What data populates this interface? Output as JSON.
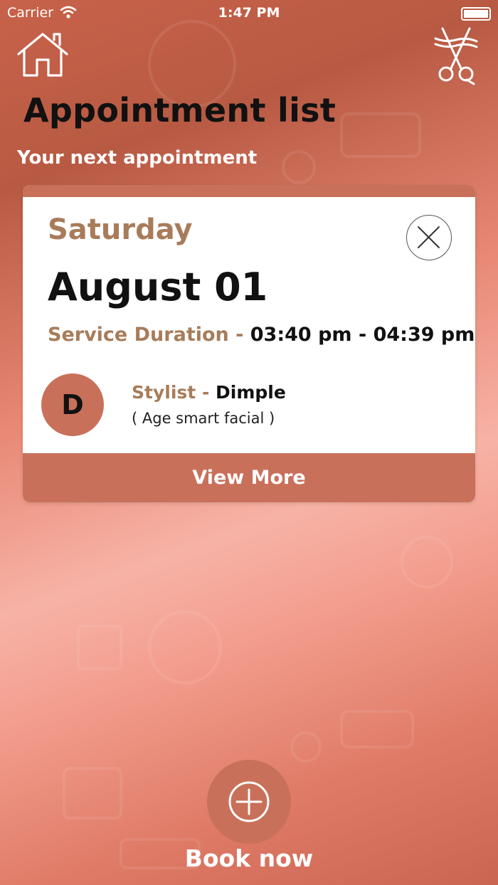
{
  "status_bar": {
    "carrier": "Carrier",
    "time": "1:47 PM"
  },
  "header": {
    "title": "Appointment list",
    "home_icon": "home-icon",
    "scissors_icon": "scissors-icon"
  },
  "section": {
    "label": "Your next appointment"
  },
  "appointment": {
    "day": "Saturday",
    "date": "August 01",
    "duration_label": "Service Duration",
    "separator": " - ",
    "duration_value": "03:40 pm - 04:39 pm",
    "avatar_initial": "D",
    "stylist_label": "Stylist",
    "stylist_name": "Dimple",
    "service": "( Age smart facial )",
    "view_more": "View More",
    "close_icon": "close-icon"
  },
  "book": {
    "label": "Book now",
    "icon": "plus-circle-icon"
  },
  "colors": {
    "accent": "#c9705a",
    "label_brown": "#a87c5a",
    "title_text": "#111111"
  }
}
